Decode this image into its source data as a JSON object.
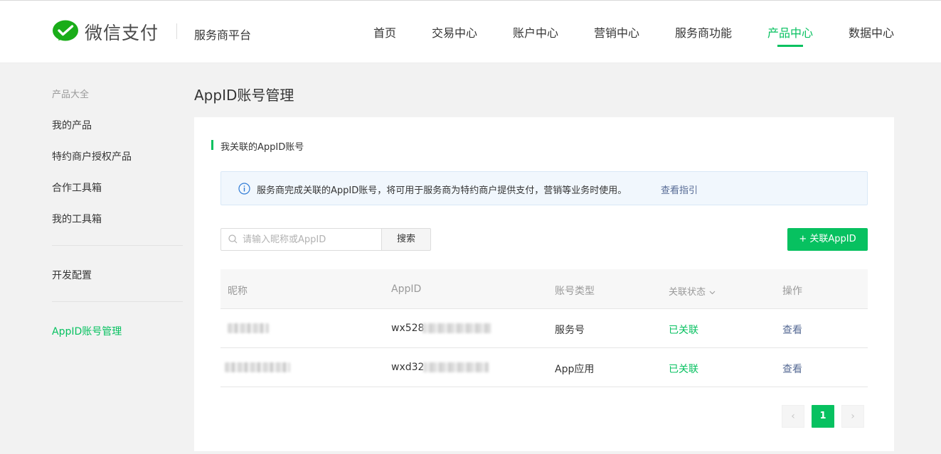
{
  "header": {
    "logo_text": "微信支付",
    "platform": "服务商平台",
    "nav": [
      {
        "label": "首页"
      },
      {
        "label": "交易中心"
      },
      {
        "label": "账户中心"
      },
      {
        "label": "营销中心"
      },
      {
        "label": "服务商功能"
      },
      {
        "label": "产品中心",
        "active": true
      },
      {
        "label": "数据中心"
      }
    ]
  },
  "sidebar": {
    "heading": "产品大全",
    "items": [
      {
        "label": "我的产品"
      },
      {
        "label": "特约商户授权产品"
      },
      {
        "label": "合作工具箱"
      },
      {
        "label": "我的工具箱"
      },
      {
        "label": "开发配置"
      },
      {
        "label": "AppID账号管理",
        "active": true
      }
    ]
  },
  "main": {
    "title": "AppID账号管理",
    "section_title": "我关联的AppID账号",
    "notice": {
      "icon": "info-circle-icon",
      "text": "服务商完成关联的AppID账号，将可用于服务商为特约商户提供支付，营销等业务时使用。",
      "link": "查看指引"
    },
    "search": {
      "placeholder": "请输入昵称或AppID",
      "button": "搜索"
    },
    "add_button": "+ 关联AppID",
    "table": {
      "columns": [
        "昵称",
        "AppID",
        "账号类型",
        "关联状态",
        "操作"
      ],
      "rows": [
        {
          "nickname": "",
          "appid_prefix": "wx528",
          "type": "服务号",
          "status": "已关联",
          "action": "查看"
        },
        {
          "nickname": "",
          "appid_prefix": "wxd32",
          "type": "App应用",
          "status": "已关联",
          "action": "查看"
        }
      ]
    },
    "pagination": {
      "prev": "‹",
      "current": "1",
      "next": "›"
    }
  },
  "colors": {
    "accent": "#07c160",
    "link": "#576b95",
    "notice_bg": "#f1f7fd"
  }
}
